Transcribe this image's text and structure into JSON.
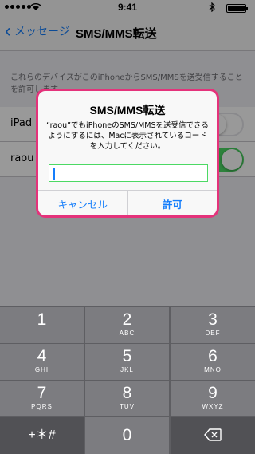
{
  "status_bar": {
    "time": "9:41"
  },
  "nav": {
    "back_label": "メッセージ",
    "title": "SMS/MMS転送"
  },
  "settings": {
    "description": "これらのデバイスがこのiPhoneからSMS/MMSを送受信することを許可します",
    "rows": [
      {
        "label": "iPad",
        "toggle_on": false
      },
      {
        "label": "raou",
        "toggle_on": true
      }
    ]
  },
  "alert": {
    "title": "SMS/MMS転送",
    "message": "“raou”でもiPhoneのSMS/MMSを送受信できるようにするには、Macに表示されているコードを入力してください。",
    "input_value": "",
    "cancel_label": "キャンセル",
    "allow_label": "許可"
  },
  "keypad": {
    "keys": [
      {
        "num": "1",
        "letters": ""
      },
      {
        "num": "2",
        "letters": "ABC"
      },
      {
        "num": "3",
        "letters": "DEF"
      },
      {
        "num": "4",
        "letters": "GHI"
      },
      {
        "num": "5",
        "letters": "JKL"
      },
      {
        "num": "6",
        "letters": "MNO"
      },
      {
        "num": "7",
        "letters": "PQRS"
      },
      {
        "num": "8",
        "letters": "TUV"
      },
      {
        "num": "9",
        "letters": "WXYZ"
      }
    ],
    "symbols_label": "+＊#",
    "zero": "0",
    "delete_icon": "delete-backspace-icon"
  }
}
